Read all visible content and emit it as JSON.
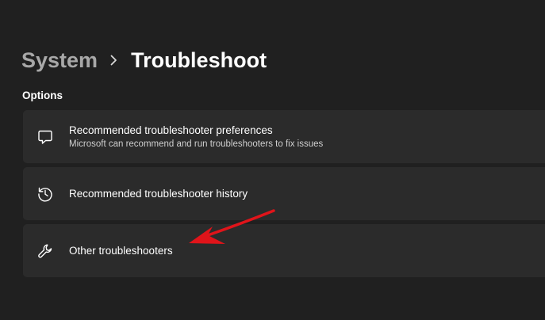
{
  "breadcrumb": {
    "parent": "System",
    "current": "Troubleshoot"
  },
  "section": {
    "label": "Options"
  },
  "items": [
    {
      "title": "Recommended troubleshooter preferences",
      "subtitle": "Microsoft can recommend and run troubleshooters to fix issues",
      "icon": "chat-bubble-icon"
    },
    {
      "title": "Recommended troubleshooter history",
      "icon": "history-icon"
    },
    {
      "title": "Other troubleshooters",
      "icon": "wrench-icon"
    }
  ],
  "colors": {
    "background": "#202020",
    "card": "#2b2b2b",
    "annotation_arrow": "#e0141a"
  }
}
